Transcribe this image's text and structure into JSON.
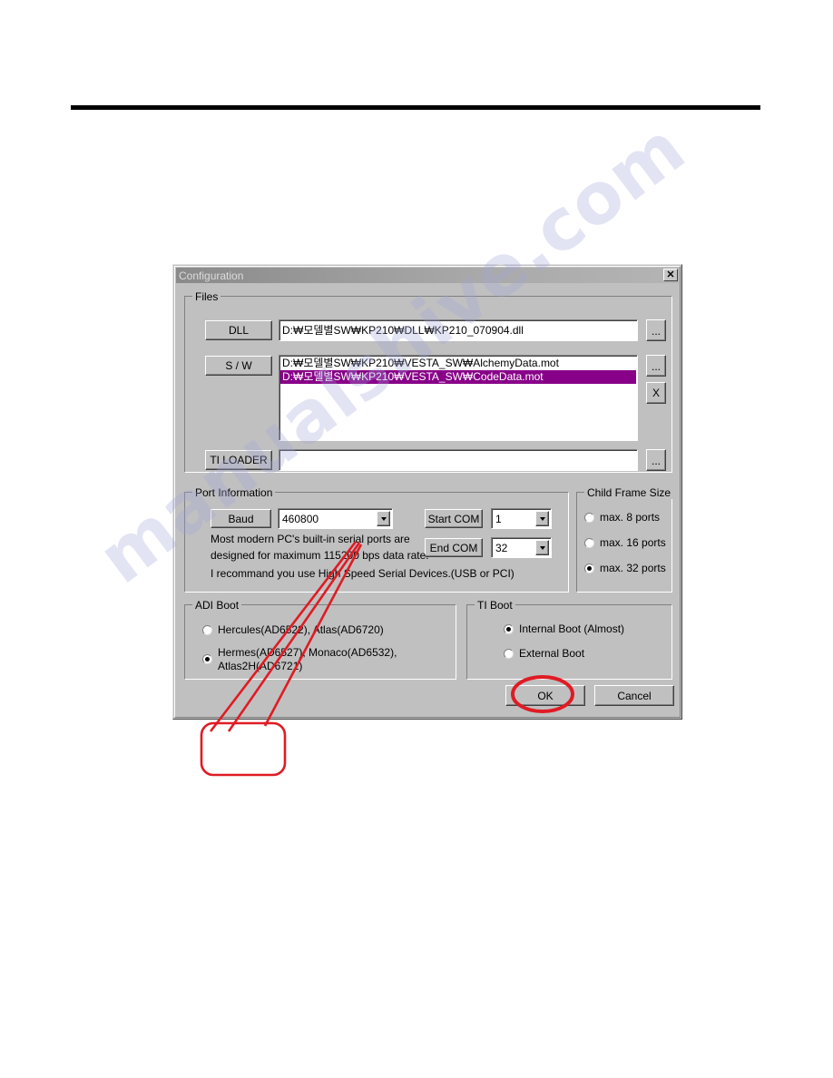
{
  "document": {
    "rule_visible": true,
    "watermark_text": "manualshive.com"
  },
  "dialog": {
    "title": "Configuration",
    "close_label": "✕",
    "files": {
      "legend": "Files",
      "dll_button": "DLL",
      "dll_path": "D:₩모델별SW₩KP210₩DLL₩KP210_070904.dll",
      "dll_browse": "...",
      "sw_button": "S / W",
      "sw_browse": "...",
      "sw_delete": "X",
      "sw_items": [
        {
          "path": "D:₩모델별SW₩KP210₩VESTA_SW₩AlchemyData.mot",
          "selected": false
        },
        {
          "path": "D:₩모델별SW₩KP210₩VESTA_SW₩CodeData.mot",
          "selected": true
        }
      ],
      "tiloader_button": "TI LOADER",
      "tiloader_path": "",
      "tiloader_browse": "..."
    },
    "port_information": {
      "legend": "Port Information",
      "baud_button": "Baud",
      "baud_value": "460800",
      "start_com_button": "Start COM",
      "start_com_value": "1",
      "end_com_button": "End COM",
      "end_com_value": "32",
      "note_line1": "Most modern PC's built-in serial ports are",
      "note_line2": "designed for maximum 115200 bps data rate.",
      "note_line3": "I recommand you use High Speed Serial Devices.(USB or PCI)"
    },
    "child_frame_size": {
      "legend": "Child Frame Size",
      "options": [
        {
          "label": "max. 8 ports",
          "selected": false
        },
        {
          "label": "max. 16 ports",
          "selected": false
        },
        {
          "label": "max. 32 ports",
          "selected": true
        }
      ]
    },
    "adi_boot": {
      "legend": "ADI Boot",
      "options": [
        {
          "label": "Hercules(AD6522), Atlas(AD6720)",
          "label2": "",
          "selected": false
        },
        {
          "label": "Hermes(AD6527), Monaco(AD6532),",
          "label2": "Atlas2H(AD6721)",
          "selected": true
        }
      ]
    },
    "ti_boot": {
      "legend": "TI Boot",
      "options": [
        {
          "label": "Internal Boot (Almost)",
          "selected": true
        },
        {
          "label": "External Boot",
          "selected": false
        }
      ]
    },
    "ok_button": "OK",
    "cancel_button": "Cancel"
  },
  "annotations": {
    "accent_color": "#e01b24",
    "callout_box_text": "",
    "highlight_target": "OK"
  }
}
